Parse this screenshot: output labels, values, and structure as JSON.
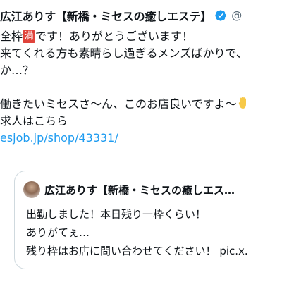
{
  "tweet": {
    "display_name": "広江ありす【新橋・ミセスの癒しエステ】",
    "handle": "@",
    "lines": {
      "l1_before": "全枠",
      "l1_badge": "満",
      "l1_after": "です！ありがとうございます！",
      "l2": "来てくれる方も素晴らし過ぎるメンズばかりで、",
      "l3": "か…？",
      "l5": "働きたいミセスさ〜ん、このお店良いですよ〜",
      "l6": "求人はこちら",
      "link": "esjob.jp/shop/43331/"
    }
  },
  "quote": {
    "display_name": "広江ありす【新橋・ミセスの癒しエス…",
    "lines": [
      "出勤しました！本日残り一枠くらい！",
      "ありがてぇ…",
      "残り枠はお店に問い合わせてください！ pic.x."
    ]
  },
  "colors": {
    "link": "#1d9bf0",
    "verified": "#1d9bf0",
    "badge": "#e0433b",
    "border": "#cfd9de",
    "secondary_text": "#536471"
  }
}
